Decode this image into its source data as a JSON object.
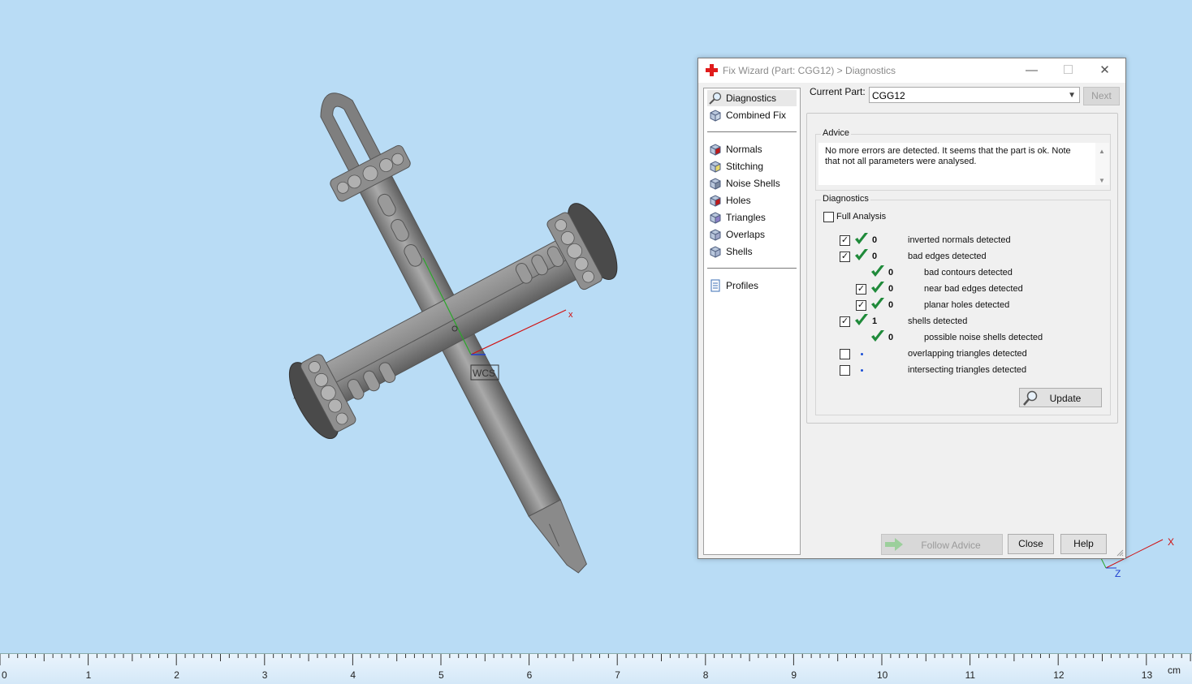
{
  "window": {
    "title": "Fix Wizard (Part: CGG12) > Diagnostics",
    "minimize": "—",
    "maximize": "☐",
    "close": "✕"
  },
  "nav": {
    "group1": [
      {
        "label": "Diagnostics",
        "icon": "magnifier-icon",
        "selected": true
      },
      {
        "label": "Combined Fix",
        "icon": "cube-icon"
      }
    ],
    "group2": [
      {
        "label": "Normals",
        "icon": "normals-cube-icon"
      },
      {
        "label": "Stitching",
        "icon": "stitching-cube-icon"
      },
      {
        "label": "Noise Shells",
        "icon": "noise-cube-icon"
      },
      {
        "label": "Holes",
        "icon": "holes-cube-icon"
      },
      {
        "label": "Triangles",
        "icon": "triangles-cube-icon"
      },
      {
        "label": "Overlaps",
        "icon": "overlaps-cube-icon"
      },
      {
        "label": "Shells",
        "icon": "shells-cube-icon"
      }
    ],
    "group3": [
      {
        "label": "Profiles",
        "icon": "document-icon"
      }
    ]
  },
  "current_part": {
    "label": "Current Part:",
    "value": "CGG12"
  },
  "buttons": {
    "next": "Next",
    "update": "Update",
    "follow_advice": "Follow Advice",
    "close": "Close",
    "help": "Help"
  },
  "advice": {
    "title": "Advice",
    "text": "No more errors are detected. It seems that the part is ok. Note that not all parameters were analysed."
  },
  "diagnostics": {
    "title": "Diagnostics",
    "full_analysis": {
      "label": "Full Analysis",
      "checked": false
    },
    "rows": [
      {
        "checkbox": true,
        "checked": true,
        "status": "ok",
        "count": "0",
        "label": "inverted normals detected",
        "indent": 0
      },
      {
        "checkbox": true,
        "checked": true,
        "status": "ok",
        "count": "0",
        "label": "bad edges detected",
        "indent": 0
      },
      {
        "checkbox": false,
        "status": "ok",
        "count": "0",
        "label": "bad contours detected",
        "indent": 1
      },
      {
        "checkbox": true,
        "checked": true,
        "status": "ok",
        "count": "0",
        "label": "near bad edges detected",
        "indent": 1
      },
      {
        "checkbox": true,
        "checked": true,
        "status": "ok",
        "count": "0",
        "label": "planar holes detected",
        "indent": 1
      },
      {
        "checkbox": true,
        "checked": true,
        "status": "ok",
        "count": "1",
        "label": "shells detected",
        "indent": 0
      },
      {
        "checkbox": false,
        "status": "ok",
        "count": "0",
        "label": "possible noise shells detected",
        "indent": 1
      },
      {
        "checkbox": true,
        "checked": false,
        "status": "pending",
        "count": "",
        "label": "overlapping triangles detected",
        "indent": 0
      },
      {
        "checkbox": true,
        "checked": false,
        "status": "pending",
        "count": "",
        "label": "intersecting triangles detected",
        "indent": 0
      }
    ]
  },
  "viewport": {
    "wcs_label": "WCS",
    "axis_x": "x",
    "mini_axis_x": "X",
    "mini_axis_z": "Z"
  },
  "ruler": {
    "unit": "cm",
    "ticks": [
      "0",
      "1",
      "2",
      "3",
      "4",
      "5",
      "6",
      "7",
      "8",
      "9",
      "10",
      "11",
      "12",
      "13"
    ]
  },
  "colors": {
    "background": "#b9dcf5",
    "model": "#8c8c8c",
    "ok_check": "#1f8a3a",
    "axis_x": "#d01010",
    "axis_y": "#2aa82a"
  }
}
